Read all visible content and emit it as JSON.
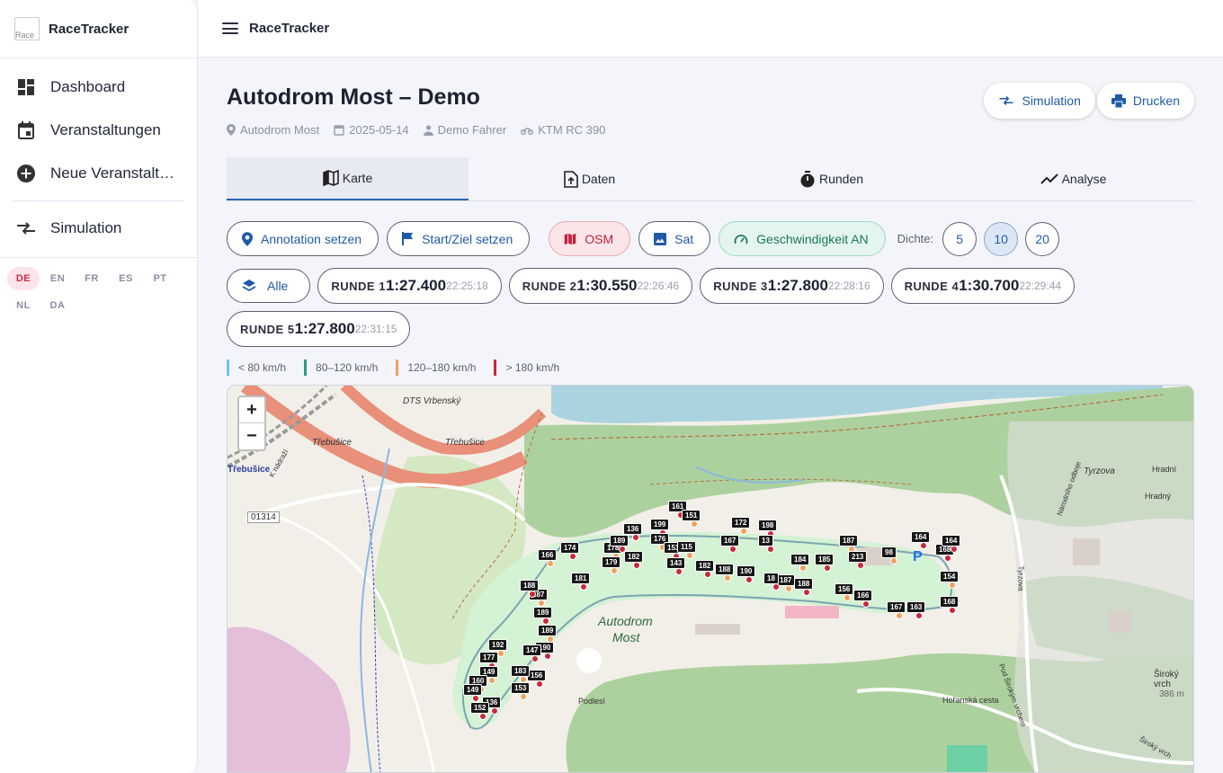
{
  "app": {
    "brand": "RaceTracker",
    "logo_alt": "Race",
    "topbar_title": "RaceTracker"
  },
  "sidebar": {
    "items": [
      {
        "label": "Dashboard",
        "icon": "dashboard-icon"
      },
      {
        "label": "Veranstaltungen",
        "icon": "calendar-icon"
      },
      {
        "label": "Neue Veranstalt…",
        "icon": "add-circle-icon"
      },
      {
        "label": "Simulation",
        "icon": "compare-arrows-icon"
      }
    ],
    "languages": [
      "DE",
      "EN",
      "FR",
      "ES",
      "PT",
      "NL",
      "DA"
    ],
    "active_language": "DE"
  },
  "page": {
    "title": "Autodrom Most – Demo",
    "meta": {
      "location": "Autodrom Most",
      "date": "2025-05-14",
      "driver": "Demo Fahrer",
      "vehicle": "KTM RC 390"
    },
    "buttons": {
      "simulation": "Simulation",
      "print": "Drucken"
    }
  },
  "tabs": [
    {
      "label": "Karte",
      "active": true
    },
    {
      "label": "Daten",
      "active": false
    },
    {
      "label": "Runden",
      "active": false
    },
    {
      "label": "Analyse",
      "active": false
    }
  ],
  "toolbar": {
    "annotation": "Annotation setzen",
    "startziel": "Start/Ziel setzen",
    "osm": "OSM",
    "sat": "Sat",
    "speed": "Geschwindigkeit AN",
    "dichte_label": "Dichte:",
    "dichte_options": [
      "5",
      "10",
      "20"
    ],
    "dichte_selected": "10"
  },
  "laps": {
    "all_label": "Alle",
    "items": [
      {
        "name": "RUNDE 1",
        "time": "1:27.400",
        "clock": "22:25:18"
      },
      {
        "name": "RUNDE 2",
        "time": "1:30.550",
        "clock": "22:26:46"
      },
      {
        "name": "RUNDE 3",
        "time": "1:27.800",
        "clock": "22:28:16"
      },
      {
        "name": "RUNDE 4",
        "time": "1:30.700",
        "clock": "22:29:44"
      },
      {
        "name": "RUNDE 5",
        "time": "1:27.800",
        "clock": "22:31:15"
      }
    ]
  },
  "legend": [
    {
      "label": "< 80 km/h",
      "color": "#6fc3e8"
    },
    {
      "label": "80–120 km/h",
      "color": "#2a9a86"
    },
    {
      "label": "120–180 km/h",
      "color": "#f0a060"
    },
    {
      "label": "> 180 km/h",
      "color": "#c8283c"
    }
  ],
  "map": {
    "zoom_in": "+",
    "zoom_out": "−",
    "labels": {
      "trebusice1": "Třebušice",
      "trebusice2": "Třebušice",
      "trebusice3": "Třebušice",
      "dts": "DTS Vrbenský",
      "road": "01314",
      "autodrom": "Autodrom",
      "most": "Most",
      "tyrzova": "Tyrzova",
      "sirokyvrch": "Široký vrch",
      "sirokyvrch_elev": "386 m",
      "hradni": "Hradní",
      "hradny": "Hradný",
      "horanska": "Hořanská cesta",
      "podlesi": "Podlesí",
      "parking": "P",
      "narodniho": "Národního odboje",
      "podsiroky": "Pod Širokým vrchem",
      "tyrzova2": "Tyrzova",
      "knadrazi": "K nádraží",
      "siroky2": "Široký vrch"
    },
    "markers": [
      "161",
      "151",
      "199",
      "172",
      "198",
      "136",
      "176",
      "167",
      "187",
      "164",
      "168",
      "166",
      "174",
      "178",
      "189",
      "153",
      "115",
      "13",
      "179",
      "182",
      "213",
      "98",
      "185",
      "184",
      "143",
      "182",
      "188",
      "190",
      "187",
      "188",
      "18",
      "156",
      "166",
      "167",
      "163",
      "168",
      "154",
      "164",
      "187",
      "188",
      "189",
      "189",
      "190",
      "192",
      "177",
      "147",
      "149",
      "156",
      "160",
      "149",
      "136",
      "153",
      "152",
      "183",
      "181"
    ]
  }
}
